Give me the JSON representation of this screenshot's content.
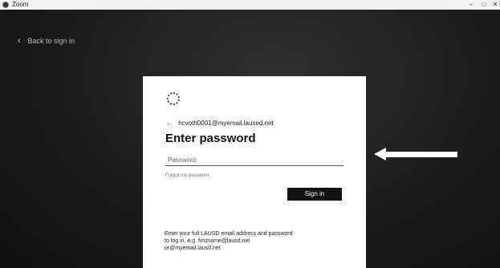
{
  "window": {
    "title": "Zoom",
    "minimize_glyph": "–",
    "maximize_glyph": "□",
    "close_glyph": "✕"
  },
  "back_link": {
    "glyph": "‹",
    "label": "Back to sign in"
  },
  "signin_card": {
    "back_arrow_glyph": "←",
    "email": "hcvoth0001@myemail.laused.net",
    "heading": "Enter password",
    "password_placeholder": "Password",
    "forgot_password": "Forgot my password",
    "signin_button": "Sign in",
    "info_lines": [
      "Enter your full LAUSD email address and password",
      "to log in, e.g. firstname@lausd.net",
      "or@myemail.lausd.net"
    ]
  },
  "colors": {
    "background": "#1b1b1b",
    "card": "#ffffff",
    "button": "#111111",
    "arrow": "#ffffff"
  },
  "icons": [
    "app-icon",
    "chevron-left-icon",
    "org-logo-icon",
    "back-arrow-icon",
    "callout-arrow-icon"
  ]
}
